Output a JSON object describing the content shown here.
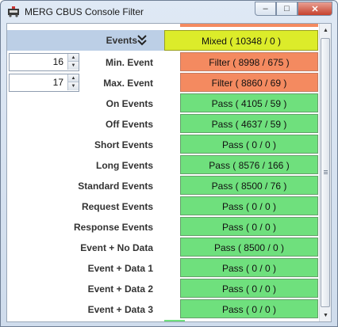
{
  "window": {
    "title": "MERG CBUS Console Filter",
    "controls": {
      "minimize": "–",
      "maximize": "□",
      "close": "✕"
    }
  },
  "header": {
    "label": "Events",
    "icon": "double-chevron-down-icon",
    "status": "Mixed ( 10348 / 0 )",
    "status_type": "mixed"
  },
  "spinners": [
    {
      "label": "Min. Event",
      "value": "16",
      "status": "Filter ( 8998 / 675 )",
      "status_type": "filter"
    },
    {
      "label": "Max. Event",
      "value": "17",
      "status": "Filter ( 8860 / 69 )",
      "status_type": "filter"
    }
  ],
  "rows": [
    {
      "label": "On Events",
      "status": "Pass ( 4105 / 59 )",
      "status_type": "pass"
    },
    {
      "label": "Off Events",
      "status": "Pass ( 4637 / 59 )",
      "status_type": "pass"
    },
    {
      "label": "Short Events",
      "status": "Pass ( 0 / 0 )",
      "status_type": "pass"
    },
    {
      "label": "Long Events",
      "status": "Pass ( 8576 / 166 )",
      "status_type": "pass"
    },
    {
      "label": "Standard Events",
      "status": "Pass ( 8500 / 76 )",
      "status_type": "pass"
    },
    {
      "label": "Request Events",
      "status": "Pass ( 0 / 0 )",
      "status_type": "pass"
    },
    {
      "label": "Response Events",
      "status": "Pass ( 0 / 0 )",
      "status_type": "pass"
    },
    {
      "label": "Event + No Data",
      "status": "Pass ( 8500 / 0 )",
      "status_type": "pass"
    },
    {
      "label": "Event + Data 1",
      "status": "Pass ( 0 / 0 )",
      "status_type": "pass"
    },
    {
      "label": "Event + Data 2",
      "status": "Pass ( 0 / 0 )",
      "status_type": "pass"
    },
    {
      "label": "Event + Data 3",
      "status": "Pass ( 0 / 0 )",
      "status_type": "pass"
    }
  ],
  "colors": {
    "pass": "#6fe07d",
    "filter": "#f48a60",
    "mixed": "#dcec2a",
    "header_bg": "#bccfe6"
  }
}
